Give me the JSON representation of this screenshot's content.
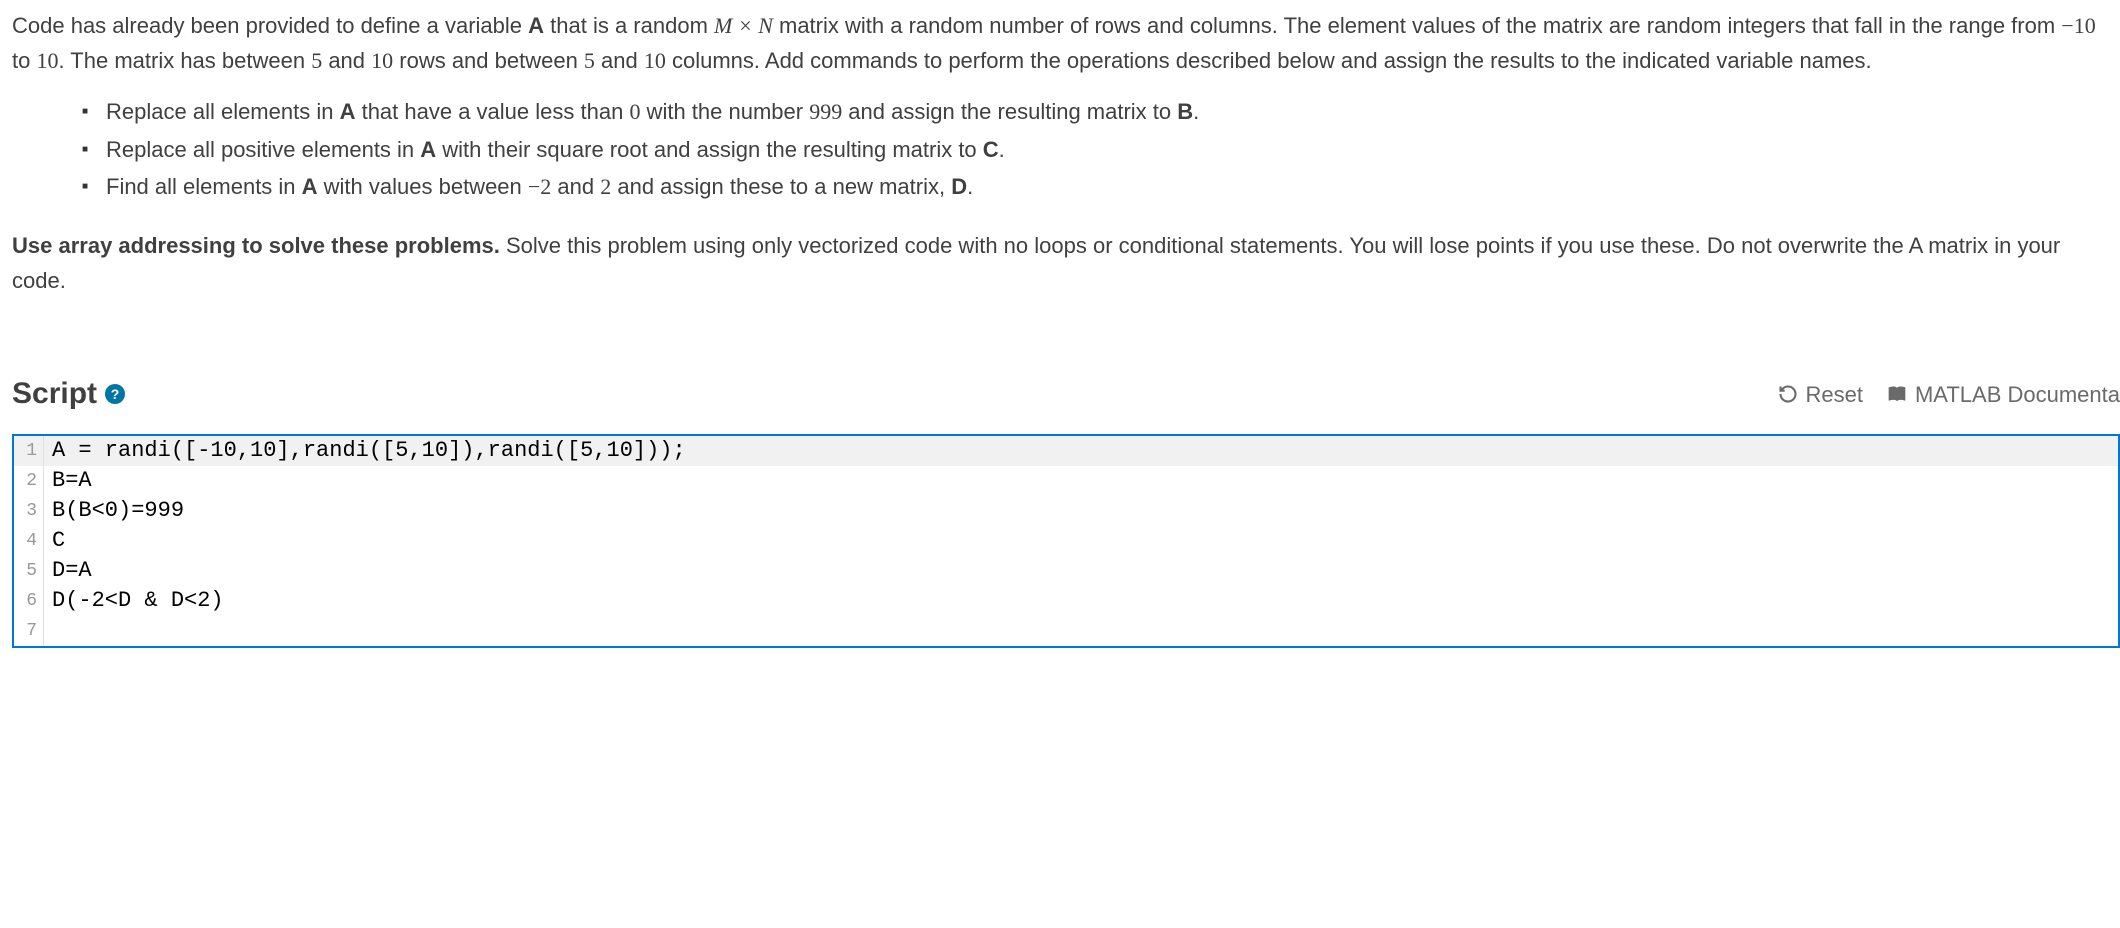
{
  "problem": {
    "para1_pre": "Code has already been provided to define a variable ",
    "A": "A",
    "para1_mid1": " that is a random ",
    "MxN": "M × N",
    "para1_mid2": " matrix with a random number of rows and columns. The element values of the matrix are random integers that fall in the range from ",
    "neg10": "−10",
    "para1_mid3": " to ",
    "ten": "10",
    "para1_mid4": ". The matrix has between ",
    "five": "5",
    "para1_mid5": " and ",
    "ten2": "10",
    "para1_mid6": " rows and between ",
    "five2": "5",
    "para1_mid7": " and ",
    "ten3": "10",
    "para1_mid8": " columns.  Add commands to perform the operations described below and assign the results to the indicated variable names.",
    "bullets": [
      {
        "pre": "Replace all elements in ",
        "var1": "A",
        "mid1": " that have a value less than ",
        "num1": "0",
        "mid2": " with the number ",
        "num2": "999",
        "mid3": " and assign the resulting matrix to ",
        "var2": "B",
        "post": "."
      },
      {
        "pre": "Replace all positive elements in ",
        "var1": "A",
        "mid1": " with their square root and assign the resulting matrix to ",
        "var2": "C",
        "post": "."
      },
      {
        "pre": "Find all elements in ",
        "var1": "A",
        "mid1": " with values between ",
        "num1": "−2",
        "mid2": " and ",
        "num2": "2",
        "mid3": " and assign these to a new matrix, ",
        "var2": "D",
        "post": "."
      }
    ],
    "para2_bold": "Use array addressing to solve these problems.",
    "para2_rest": " Solve this problem using only vectorized code with no loops or conditional statements. You will lose points if you use these. Do not overwrite the A matrix in your code."
  },
  "script": {
    "title": "Script",
    "help_glyph": "?",
    "reset_label": "Reset",
    "docs_label": "MATLAB Documenta"
  },
  "code": {
    "lines": [
      {
        "n": "1",
        "text": "A = randi([-10,10],randi([5,10]),randi([5,10]));",
        "active": true
      },
      {
        "n": "2",
        "text": "B=A",
        "active": false
      },
      {
        "n": "3",
        "text": "B(B<0)=999",
        "active": false
      },
      {
        "n": "4",
        "text": "C",
        "active": false
      },
      {
        "n": "5",
        "text": "D=A",
        "active": false
      },
      {
        "n": "6",
        "text": "D(-2<D & D<2)",
        "active": false
      },
      {
        "n": "7",
        "text": "",
        "active": false
      }
    ]
  }
}
